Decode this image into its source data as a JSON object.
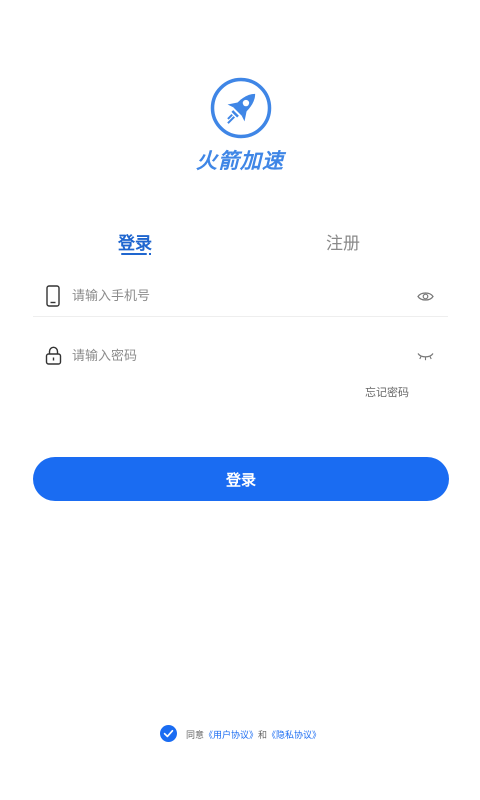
{
  "app": {
    "name": "火箭加速",
    "logo_icon": "rocket-icon"
  },
  "tabs": {
    "login_label": "登录",
    "register_label": "注册"
  },
  "form": {
    "phone_placeholder": "请输入手机号",
    "password_placeholder": "请输入密码",
    "forgot_label": "忘记密码",
    "submit_label": "登录"
  },
  "agreement": {
    "prefix": "同意",
    "user_agreement": "《用户协议》",
    "and": "和",
    "privacy_policy": "《隐私协议》",
    "checked": true
  },
  "colors": {
    "primary": "#1a6cf2",
    "tab_active": "#1f66cf",
    "logo": "#3f86e6",
    "placeholder": "#8c8c8c"
  }
}
